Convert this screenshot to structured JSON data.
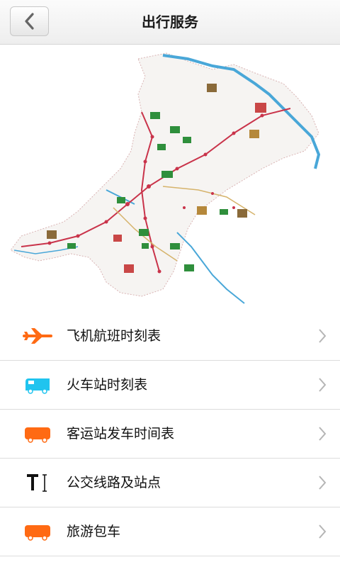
{
  "header": {
    "title": "出行服务"
  },
  "colors": {
    "accent_orange": "#ff6a13",
    "accent_cyan": "#20c4ef",
    "river_blue": "#49a7d8"
  },
  "menu": [
    {
      "label": "飞机航班时刻表",
      "icon": "airplane-icon"
    },
    {
      "label": "火车站时刻表",
      "icon": "train-icon"
    },
    {
      "label": "客运站发车时间表",
      "icon": "bus-icon"
    },
    {
      "label": "公交线路及站点",
      "icon": "text-cursor-icon"
    },
    {
      "label": "旅游包车",
      "icon": "bus-icon"
    }
  ]
}
